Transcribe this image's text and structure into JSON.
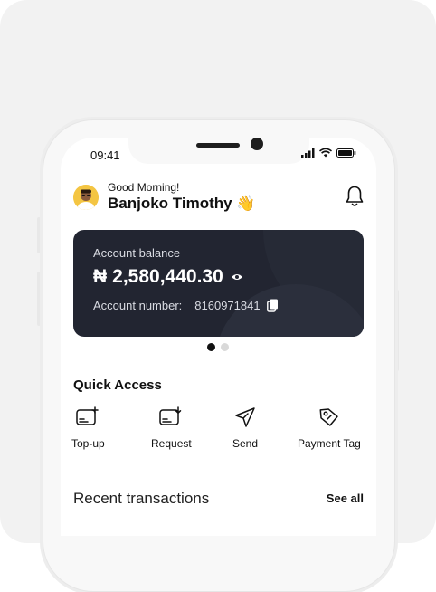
{
  "status_bar": {
    "time": "09:41"
  },
  "greeting": {
    "message": "Good Morning!",
    "name": "Banjoko Timothy 👋"
  },
  "balance_card": {
    "label": "Account balance",
    "currency_symbol": "₦",
    "amount": "2,580,440.30",
    "account_label": "Account number:",
    "account_number": "8160971841"
  },
  "carousel": {
    "pages": 2,
    "active": 0
  },
  "quick_access": {
    "title": "Quick Access",
    "items": [
      {
        "label": "Top-up",
        "icon": "wallet-plus-icon"
      },
      {
        "label": "Request",
        "icon": "wallet-download-icon"
      },
      {
        "label": "Send",
        "icon": "send-icon"
      },
      {
        "label": "Payment Tag",
        "icon": "tag-icon"
      }
    ]
  },
  "recent_transactions": {
    "title": "Recent transactions",
    "see_all": "See all"
  }
}
